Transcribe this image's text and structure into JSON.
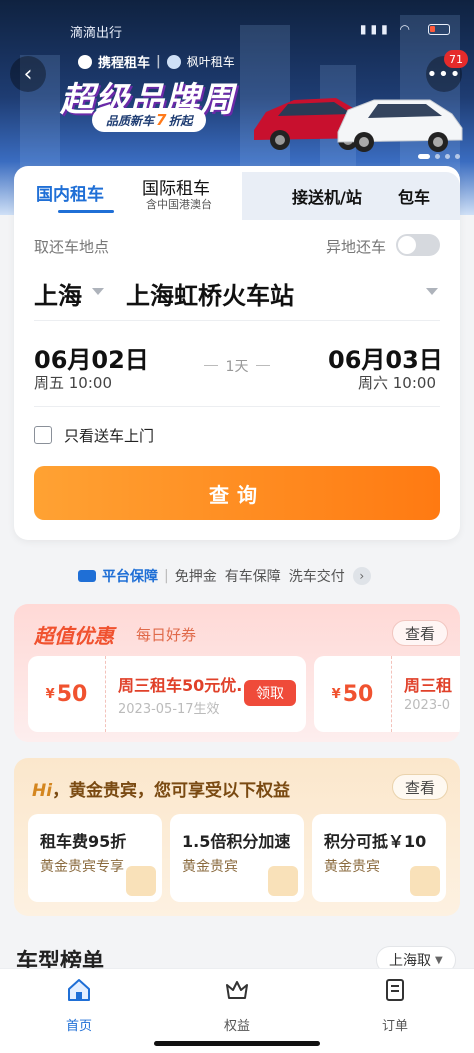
{
  "status_bar": {
    "time": "滴滴出行",
    "signal": "▮▮▮ ◠"
  },
  "banner": {
    "brand": "携程租车",
    "partner": "枫叶租车",
    "headline": "超级品牌周",
    "promo_prefix": "品质新车",
    "promo_number": "7",
    "promo_suffix": "折起",
    "notification_count": "71"
  },
  "tabs": {
    "domestic": "国内租车",
    "international": "国际租车",
    "international_sub": "含中国港澳台",
    "transfer": "接送机/站",
    "charter": "包车"
  },
  "search": {
    "pickup_label": "取还车地点",
    "different_return_label": "异地还车",
    "city": "上海",
    "station": "上海虹桥火车站",
    "pickup_date": "06月02日",
    "pickup_weekday_time": "周五  10:00",
    "duration": "1天",
    "return_date": "06月03日",
    "return_weekday_time": "周六  10:00",
    "delivery_only_label": "只看送车上门",
    "query_button": "查询"
  },
  "guarantee": {
    "title": "平台保障",
    "items": [
      "免押金",
      "有车保障",
      "洗车交付"
    ]
  },
  "deals": {
    "title": "超值优惠",
    "subtitle": "每日好券",
    "view_button": "查看",
    "coupons": [
      {
        "currency": "¥",
        "amount": "50",
        "name": "周三租车50元优...",
        "effective": "2023-05-17生效",
        "claim": "领取"
      },
      {
        "currency": "¥",
        "amount": "50",
        "name": "周三租",
        "effective": "2023-0"
      }
    ]
  },
  "member": {
    "title_prefix": "Hi",
    "title": "，黄金贵宾，您可享受以下权益",
    "view_button": "查看",
    "perks": [
      {
        "title": "租车费95折",
        "subtitle": "黄金贵宾专享"
      },
      {
        "title": "1.5倍积分加速",
        "subtitle": "黄金贵宾"
      },
      {
        "title": "积分可抵￥10",
        "subtitle": "黄金贵宾"
      }
    ]
  },
  "ranking": {
    "title": "车型榜单",
    "city": "上海取"
  },
  "bottom_nav": [
    {
      "label": "首页",
      "icon": "home-icon",
      "active": true
    },
    {
      "label": "权益",
      "icon": "crown-icon",
      "active": false
    },
    {
      "label": "订单",
      "icon": "order-list-icon",
      "active": false
    }
  ],
  "colors": {
    "accent": "#1f6fd6",
    "cta": "#ff8a1f",
    "deal_red": "#f0522f",
    "gold": "#7a4a12"
  }
}
